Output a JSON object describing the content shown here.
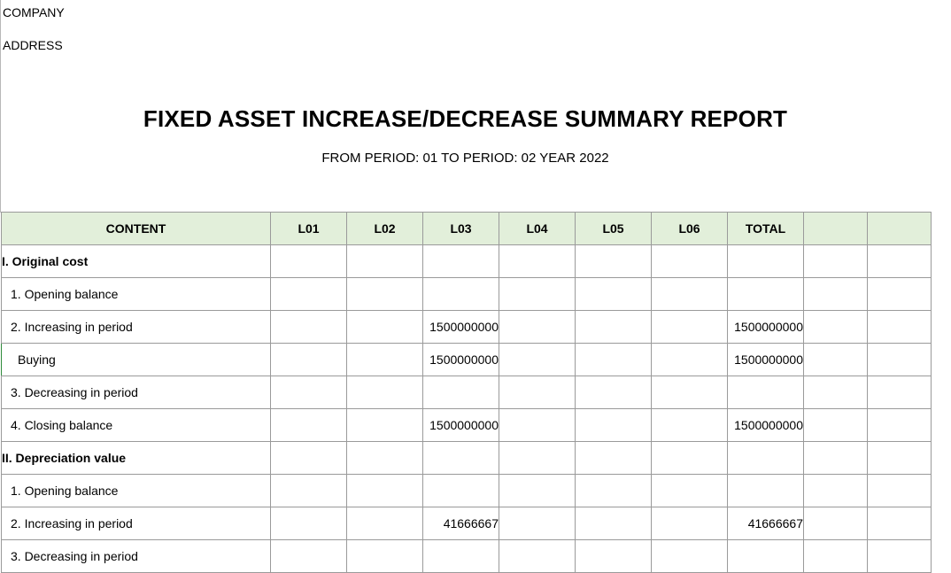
{
  "header": {
    "company": "COMPANY",
    "address": "ADDRESS"
  },
  "report": {
    "title": "FIXED ASSET INCREASE/DECREASE SUMMARY REPORT",
    "subtitle": "FROM PERIOD: 01 TO PERIOD: 02 YEAR 2022"
  },
  "table": {
    "columns": [
      "CONTENT",
      "L01",
      "L02",
      "L03",
      "L04",
      "L05",
      "L06",
      "TOTAL",
      "",
      ""
    ],
    "rows": [
      {
        "label": "I. Original cost",
        "cells": [
          "",
          "",
          "",
          "",
          "",
          "",
          "",
          "",
          ""
        ]
      },
      {
        "label": "1. Opening balance",
        "cells": [
          "",
          "",
          "",
          "",
          "",
          "",
          "",
          "",
          ""
        ]
      },
      {
        "label": "2. Increasing in period",
        "cells": [
          "",
          "",
          "1500000000",
          "",
          "",
          "",
          "1500000000",
          "",
          ""
        ]
      },
      {
        "label": "Buying",
        "cells": [
          "",
          "",
          "1500000000",
          "",
          "",
          "",
          "1500000000",
          "",
          ""
        ]
      },
      {
        "label": "3. Decreasing in period",
        "cells": [
          "",
          "",
          "",
          "",
          "",
          "",
          "",
          "",
          ""
        ]
      },
      {
        "label": "4. Closing balance",
        "cells": [
          "",
          "",
          "1500000000",
          "",
          "",
          "",
          "1500000000",
          "",
          ""
        ]
      },
      {
        "label": "II. Depreciation value",
        "cells": [
          "",
          "",
          "",
          "",
          "",
          "",
          "",
          "",
          ""
        ]
      },
      {
        "label": "1. Opening balance",
        "cells": [
          "",
          "",
          "",
          "",
          "",
          "",
          "",
          "",
          ""
        ]
      },
      {
        "label": "2. Increasing in period",
        "cells": [
          "",
          "",
          "41666667",
          "",
          "",
          "",
          "41666667",
          "",
          ""
        ]
      },
      {
        "label": "3. Decreasing in period",
        "cells": [
          "",
          "",
          "",
          "",
          "",
          "",
          "",
          "",
          ""
        ]
      }
    ]
  }
}
